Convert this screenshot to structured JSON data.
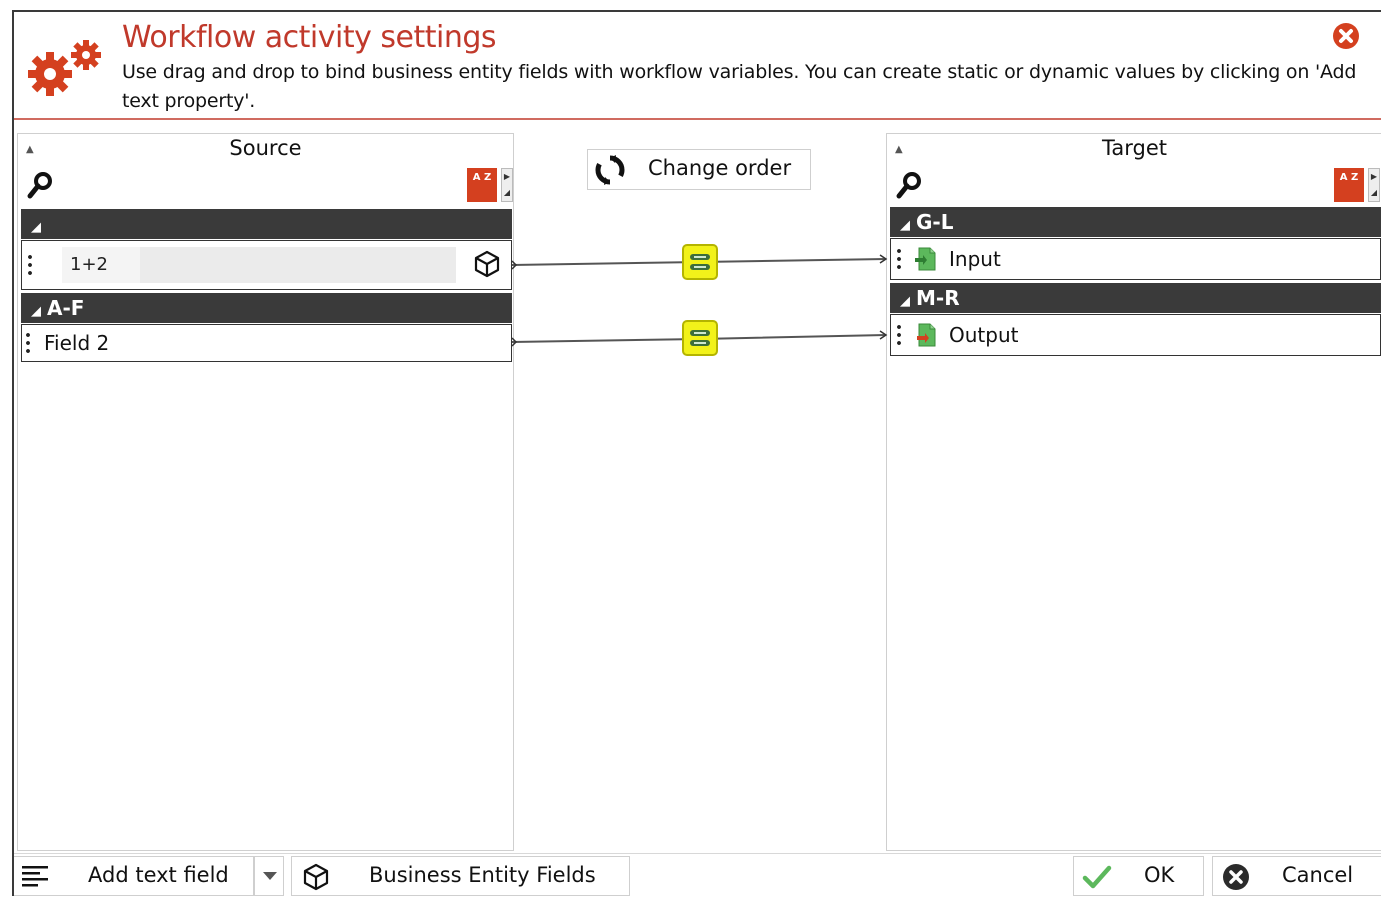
{
  "dialog": {
    "title": "Workflow activity settings",
    "description": "Use drag and drop to bind business entity fields with workflow variables. You can create static or dynamic values by clicking on 'Add text property'.",
    "close_icon": "close-circle-icon",
    "accent_color": "#c0392b"
  },
  "source": {
    "title": "Source",
    "groups": [
      {
        "label": "",
        "items": [
          {
            "value": "1+2",
            "icon": "cube-icon"
          }
        ]
      },
      {
        "label": "A-F",
        "items": [
          {
            "label": "Field 2"
          }
        ]
      }
    ]
  },
  "target": {
    "title": "Target",
    "groups": [
      {
        "label": "G-L",
        "items": [
          {
            "label": "Input",
            "icon": "input-document-icon"
          }
        ]
      },
      {
        "label": "M-R",
        "items": [
          {
            "label": "Output",
            "icon": "output-document-icon"
          }
        ]
      }
    ]
  },
  "toolbar": {
    "change_order_label": "Change order",
    "sort_label": "A Z"
  },
  "bindings": [
    {
      "source": "1+2",
      "target": "Input"
    },
    {
      "source": "Field 2",
      "target": "Output"
    }
  ],
  "footer": {
    "add_text_field_label": "Add text field",
    "business_entity_fields_label": "Business Entity Fields",
    "ok_label": "OK",
    "cancel_label": "Cancel"
  }
}
